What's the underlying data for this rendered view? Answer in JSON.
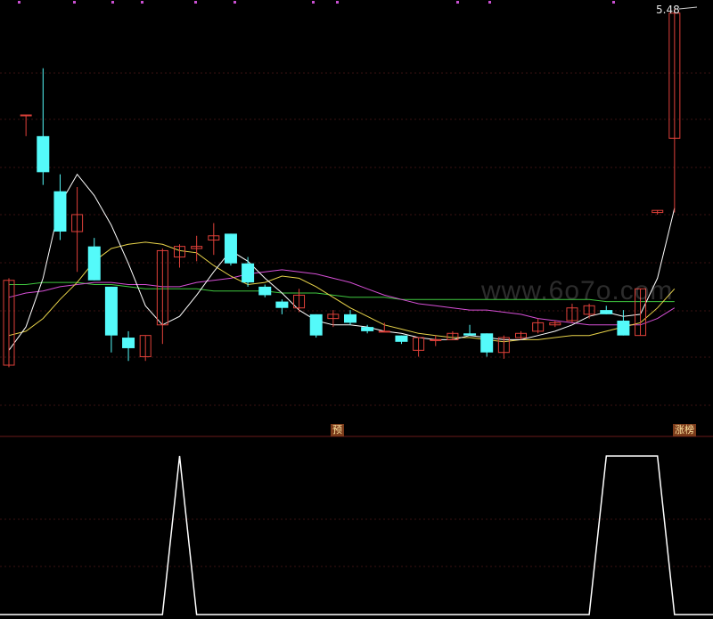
{
  "chart_data": [
    {
      "type": "candlestick",
      "price_label": "5.48",
      "markers": [
        "预",
        "涨榜"
      ],
      "watermark": "www.6o7o.com",
      "colors": {
        "up": "#e0413a",
        "down": "#54fafa",
        "ma1": "#ffffff",
        "ma2": "#e8d34a",
        "ma3": "#d64fd6",
        "ma4": "#3fc83f",
        "grid": "#3a1212"
      },
      "candles": [
        {
          "o": 3.8,
          "h": 4.21,
          "l": 3.79,
          "c": 4.2
        },
        {
          "o": 4.98,
          "h": 4.98,
          "l": 4.88,
          "c": 4.98
        },
        {
          "o": 4.88,
          "h": 5.2,
          "l": 4.65,
          "c": 4.71
        },
        {
          "o": 4.62,
          "h": 4.7,
          "l": 4.39,
          "c": 4.43
        },
        {
          "o": 4.43,
          "h": 4.64,
          "l": 4.24,
          "c": 4.51
        },
        {
          "o": 4.36,
          "h": 4.4,
          "l": 4.2,
          "c": 4.2
        },
        {
          "o": 4.17,
          "h": 4.17,
          "l": 3.86,
          "c": 3.94
        },
        {
          "o": 3.93,
          "h": 3.96,
          "l": 3.82,
          "c": 3.88
        },
        {
          "o": 3.84,
          "h": 3.94,
          "l": 3.82,
          "c": 3.94
        },
        {
          "o": 3.99,
          "h": 4.35,
          "l": 3.9,
          "c": 4.34
        },
        {
          "o": 4.31,
          "h": 4.37,
          "l": 4.26,
          "c": 4.36
        },
        {
          "o": 4.35,
          "h": 4.41,
          "l": 4.29,
          "c": 4.36
        },
        {
          "o": 4.39,
          "h": 4.47,
          "l": 4.32,
          "c": 4.41
        },
        {
          "o": 4.42,
          "h": 4.42,
          "l": 4.27,
          "c": 4.28
        },
        {
          "o": 4.28,
          "h": 4.31,
          "l": 4.17,
          "c": 4.19
        },
        {
          "o": 4.17,
          "h": 4.18,
          "l": 4.12,
          "c": 4.13
        },
        {
          "o": 4.1,
          "h": 4.11,
          "l": 4.04,
          "c": 4.07
        },
        {
          "o": 4.07,
          "h": 4.16,
          "l": 4.05,
          "c": 4.13
        },
        {
          "o": 4.04,
          "h": 4.04,
          "l": 3.93,
          "c": 3.94
        },
        {
          "o": 4.02,
          "h": 4.06,
          "l": 3.98,
          "c": 4.04
        },
        {
          "o": 4.04,
          "h": 4.06,
          "l": 3.99,
          "c": 4.0
        },
        {
          "o": 3.98,
          "h": 3.99,
          "l": 3.95,
          "c": 3.96
        },
        {
          "o": 3.96,
          "h": 4.0,
          "l": 3.96,
          "c": 3.96
        },
        {
          "o": 3.94,
          "h": 3.94,
          "l": 3.9,
          "c": 3.91
        },
        {
          "o": 3.87,
          "h": 3.93,
          "l": 3.84,
          "c": 3.93
        },
        {
          "o": 3.92,
          "h": 3.94,
          "l": 3.89,
          "c": 3.92
        },
        {
          "o": 3.92,
          "h": 3.96,
          "l": 3.92,
          "c": 3.95
        },
        {
          "o": 3.95,
          "h": 3.99,
          "l": 3.94,
          "c": 3.94
        },
        {
          "o": 3.95,
          "h": 3.95,
          "l": 3.84,
          "c": 3.86
        },
        {
          "o": 3.86,
          "h": 3.94,
          "l": 3.83,
          "c": 3.93
        },
        {
          "o": 3.93,
          "h": 3.96,
          "l": 3.92,
          "c": 3.95
        },
        {
          "o": 3.96,
          "h": 4.02,
          "l": 3.95,
          "c": 4.0
        },
        {
          "o": 3.99,
          "h": 4.01,
          "l": 3.98,
          "c": 4.0
        },
        {
          "o": 4.01,
          "h": 4.09,
          "l": 4.0,
          "c": 4.07
        },
        {
          "o": 4.04,
          "h": 4.09,
          "l": 4.02,
          "c": 4.08
        },
        {
          "o": 4.06,
          "h": 4.08,
          "l": 4.04,
          "c": 4.04
        },
        {
          "o": 4.01,
          "h": 4.06,
          "l": 3.94,
          "c": 3.94
        },
        {
          "o": 3.94,
          "h": 4.16,
          "l": 3.94,
          "c": 4.16
        },
        {
          "o": 4.52,
          "h": 4.53,
          "l": 4.51,
          "c": 4.53
        },
        {
          "o": 4.87,
          "h": 5.48,
          "l": 4.52,
          "c": 5.46
        }
      ],
      "ma1": [
        3.87,
        3.98,
        4.21,
        4.56,
        4.7,
        4.6,
        4.46,
        4.28,
        4.08,
        3.99,
        4.03,
        4.13,
        4.24,
        4.34,
        4.29,
        4.21,
        4.14,
        4.06,
        4.01,
        3.99,
        3.99,
        3.98,
        3.96,
        3.95,
        3.93,
        3.92,
        3.92,
        3.94,
        3.93,
        3.92,
        3.92,
        3.94,
        3.96,
        3.99,
        4.03,
        4.05,
        4.03,
        4.04,
        4.21,
        4.54
      ],
      "ma2": [
        3.94,
        3.96,
        4.02,
        4.11,
        4.19,
        4.29,
        4.35,
        4.37,
        4.38,
        4.37,
        4.34,
        4.33,
        4.27,
        4.22,
        4.18,
        4.19,
        4.22,
        4.21,
        4.17,
        4.12,
        4.07,
        4.03,
        3.99,
        3.97,
        3.95,
        3.94,
        3.93,
        3.93,
        3.92,
        3.91,
        3.92,
        3.92,
        3.93,
        3.94,
        3.94,
        3.96,
        3.98,
        4.0,
        4.07,
        4.16
      ],
      "ma3": [
        4.12,
        4.14,
        4.15,
        4.17,
        4.18,
        4.19,
        4.19,
        4.18,
        4.18,
        4.17,
        4.17,
        4.19,
        4.2,
        4.21,
        4.23,
        4.24,
        4.25,
        4.24,
        4.23,
        4.21,
        4.19,
        4.16,
        4.13,
        4.11,
        4.09,
        4.08,
        4.07,
        4.06,
        4.06,
        4.05,
        4.04,
        4.02,
        4.01,
        4.0,
        3.99,
        3.99,
        3.99,
        3.99,
        4.02,
        4.07
      ],
      "ma4": [
        4.18,
        4.18,
        4.19,
        4.19,
        4.19,
        4.18,
        4.18,
        4.17,
        4.16,
        4.16,
        4.16,
        4.16,
        4.15,
        4.15,
        4.15,
        4.15,
        4.14,
        4.14,
        4.14,
        4.13,
        4.12,
        4.12,
        4.12,
        4.11,
        4.11,
        4.11,
        4.11,
        4.11,
        4.11,
        4.11,
        4.11,
        4.11,
        4.11,
        4.11,
        4.11,
        4.1,
        4.1,
        4.1,
        4.1,
        4.1
      ]
    },
    {
      "type": "line",
      "x": [
        0,
        8,
        9,
        10,
        11,
        12,
        33,
        34,
        35,
        36,
        37,
        38,
        39
      ],
      "y": [
        0,
        0,
        0,
        1,
        0,
        0,
        0,
        0,
        1,
        1,
        1,
        1,
        0
      ],
      "ylim": [
        0,
        1
      ]
    }
  ]
}
